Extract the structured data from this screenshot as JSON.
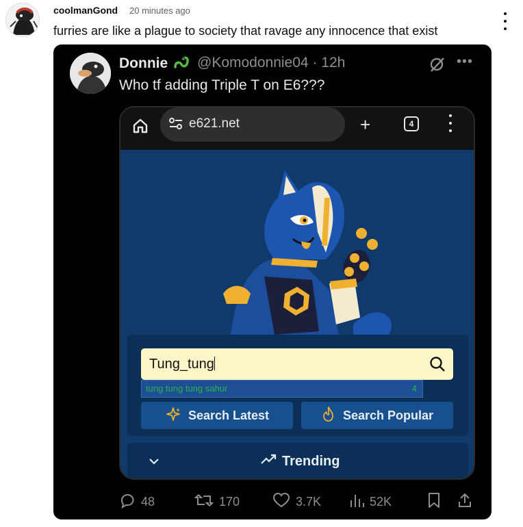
{
  "comment": {
    "author": "coolmanGond",
    "time": "20 minutes ago",
    "text": "furries are like a plague to society that ravage any innocence that exist"
  },
  "tweet": {
    "name": "Donnie",
    "handle": "@Komodonnie04 · 12h",
    "text": "Who tf adding Triple T on E6???",
    "browser": {
      "url": "e621.net",
      "tab_count": "4"
    },
    "site": {
      "search_value": "Tung_tung",
      "suggestion_term": "tung tung tung sahur",
      "suggestion_count": "4",
      "search_latest_label": "Search Latest",
      "search_popular_label": "Search Popular",
      "trending_label": "Trending",
      "accent_color": "#fdf6c8"
    },
    "actions": {
      "replies": "48",
      "retweets": "170",
      "likes": "3.7K",
      "views": "52K"
    }
  }
}
